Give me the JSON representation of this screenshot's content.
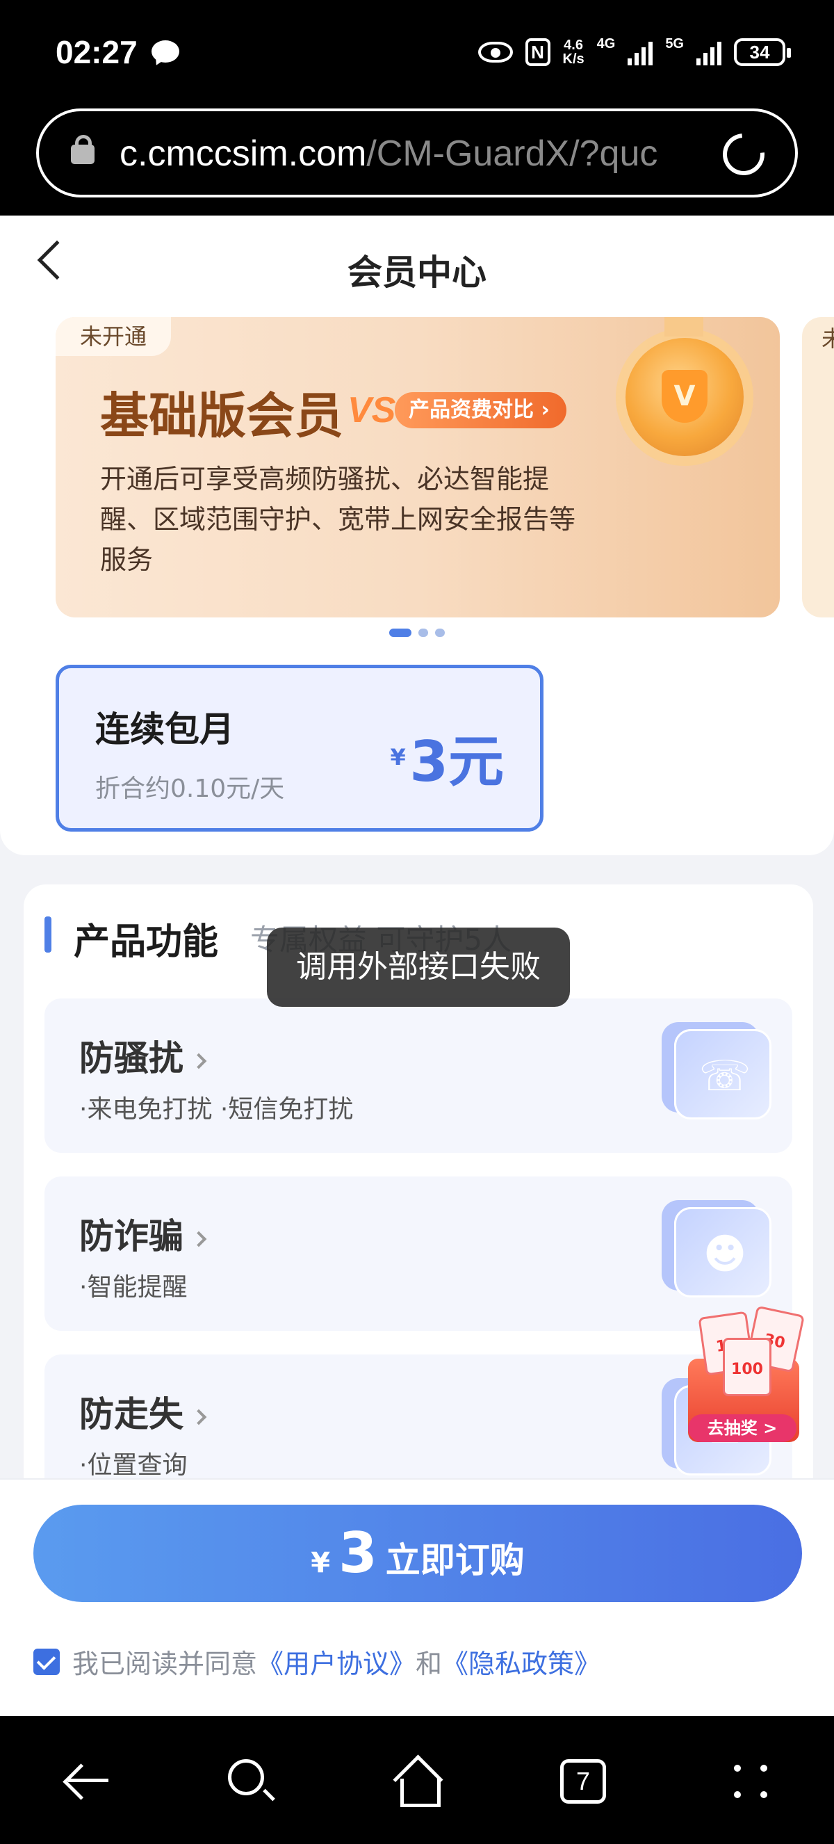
{
  "status_bar": {
    "time": "02:27",
    "speed": "4.6\nK/s",
    "net1": "4G",
    "net2": "5G",
    "battery": "34"
  },
  "browser": {
    "url_domain": "c.cmccsim.com",
    "url_path": "/CM-GuardX/?quc"
  },
  "header": {
    "title": "会员中心"
  },
  "banner": {
    "badge": "未开通",
    "title": "基础版会员",
    "vs": "VS",
    "compare_label": "产品资费对比",
    "description": "开通后可享受高频防骚扰、必达智能提醒、区域范围守护、宽带上网安全报告等服务",
    "next_badge": "未"
  },
  "plan": {
    "name": "连续包月",
    "daily": "折合约0.10元/天",
    "currency": "¥",
    "price": "3元"
  },
  "features": {
    "title": "产品功能",
    "subtitle": "专属权益 可守护5人",
    "items": [
      {
        "name": "防骚扰",
        "desc": "·来电免打扰 ·短信免打扰"
      },
      {
        "name": "防诈骗",
        "desc": "·智能提醒"
      },
      {
        "name": "防走失",
        "desc": "·位置查询"
      }
    ]
  },
  "toast": {
    "message": "调用外部接口失败"
  },
  "gift": {
    "card1": "10",
    "card2": "30",
    "card3": "100",
    "button": "去抽奖 >"
  },
  "purchase": {
    "currency": "¥",
    "amount": "3",
    "label": "立即订购",
    "agree_prefix": "我已阅读并同意",
    "agreement": "《用户协议》",
    "and": "和",
    "privacy": "《隐私政策》"
  },
  "navbar": {
    "tabs_count": "7"
  }
}
